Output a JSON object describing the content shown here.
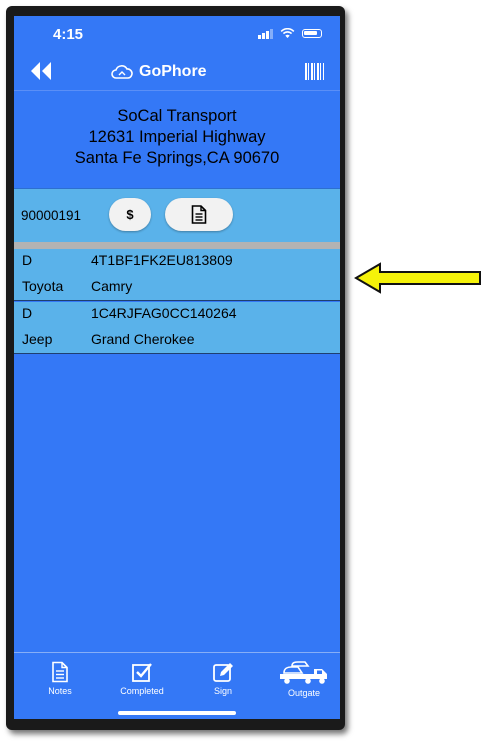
{
  "status_bar": {
    "time": "4:15"
  },
  "nav": {
    "title": "GoPhore"
  },
  "address": {
    "line1": "SoCal Transport",
    "line2": "12631 Imperial Highway",
    "line3": "Santa Fe Springs,CA 90670"
  },
  "order": {
    "number": "90000191",
    "dollar_label": "$"
  },
  "vehicles": [
    {
      "code": "D",
      "vin": "4T1BF1FK2EU813809",
      "make": "Toyota",
      "model": "Camry"
    },
    {
      "code": "D",
      "vin": "1C4RJFAG0CC140264",
      "make": "Jeep",
      "model": "Grand Cherokee"
    }
  ],
  "tabs": [
    {
      "label": "Notes",
      "icon": "notes-icon"
    },
    {
      "label": "Completed",
      "icon": "checkbox-icon"
    },
    {
      "label": "Sign",
      "icon": "sign-icon"
    },
    {
      "label": "Outgate",
      "icon": "truck-icon"
    }
  ],
  "colors": {
    "screen_bg": "#3478f6",
    "row_bg": "#5ab2ea",
    "arrow": "#f5f20a"
  }
}
